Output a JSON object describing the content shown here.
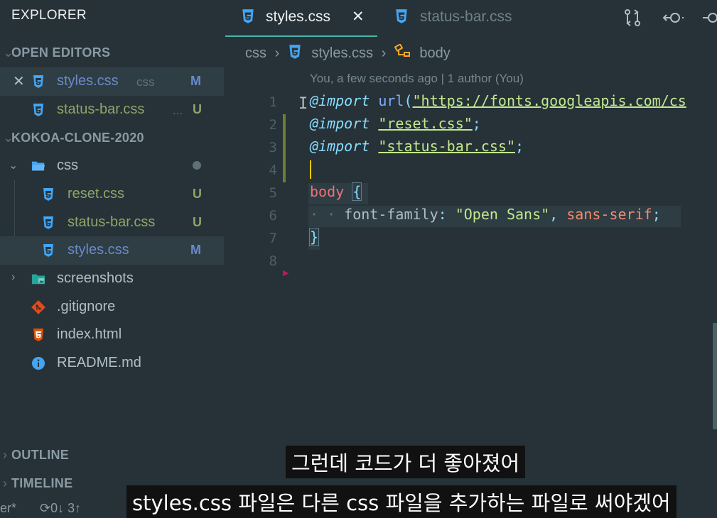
{
  "sidebar": {
    "title": "EXPLORER",
    "open_editors_label": "OPEN EDITORS",
    "project_label": "KOKOA-CLONE-2020",
    "outline_label": "OUTLINE",
    "timeline_label": "TIMELINE",
    "open_editors": [
      {
        "name": "styles.css",
        "path": "css",
        "badge": "M"
      },
      {
        "name": "status-bar.css",
        "path": "...",
        "badge": "U"
      }
    ],
    "tree": {
      "folder": "css",
      "files": [
        {
          "name": "reset.css",
          "badge": "U"
        },
        {
          "name": "status-bar.css",
          "badge": "U"
        },
        {
          "name": "styles.css",
          "badge": "M"
        }
      ],
      "other": [
        {
          "name": "screenshots",
          "type": "folder"
        },
        {
          "name": ".gitignore",
          "type": "git"
        },
        {
          "name": "index.html",
          "type": "html"
        },
        {
          "name": "README.md",
          "type": "info"
        }
      ]
    }
  },
  "status": {
    "branch": "er*",
    "sync": "0↓ 3↑"
  },
  "tabs": [
    {
      "label": "styles.css",
      "active": true,
      "close": "✕"
    },
    {
      "label": "status-bar.css",
      "active": false
    }
  ],
  "breadcrumb": {
    "folder": "css",
    "file": "styles.css",
    "symbol": "body"
  },
  "blame": "You, a few seconds ago | 1 author (You)",
  "lines": [
    "1",
    "2",
    "3",
    "4",
    "5",
    "6",
    "7",
    "8"
  ],
  "code": {
    "l1_kw": "@import",
    "l1_fn": "url",
    "l1_p1": "(",
    "l1_str": "\"https://fonts.googleapis.com/cs",
    "l2_kw": "@import",
    "l2_str": "\"reset.css\"",
    "l2_end": ";",
    "l3_kw": "@import",
    "l3_str": "\"status-bar.css\"",
    "l3_end": ";",
    "l5_sel": "body",
    "l5_brace": "{",
    "l6_dots": "· ·",
    "l6_prop": "font-family",
    "l6_colon": ":",
    "l6_str": "\"Open Sans\"",
    "l6_comma": ",",
    "l6_val": "sans-serif",
    "l6_end": ";",
    "l7_brace": "}"
  },
  "subtitles": {
    "line1": "그런데 코드가 더 좋아졌어",
    "line2": "styles.css 파일은 다른 css 파일을 추가하는 파일로 써야겠어"
  },
  "colors": {
    "css_icon": "#42a5f5",
    "modified": "#6a8acb",
    "untracked": "#8ca668"
  }
}
